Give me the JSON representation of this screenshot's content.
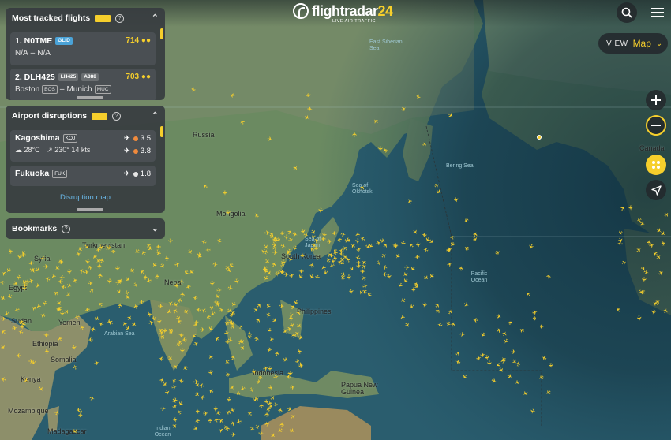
{
  "app": {
    "brand": "flightradar",
    "brand_num": "24",
    "tagline": "LIVE AIR TRAFFIC"
  },
  "view": {
    "label": "VIEW",
    "value": "Map"
  },
  "icons": {
    "search": "search-icon",
    "menu": "hamburger-menu-icon",
    "zoom_in": "plus-icon",
    "zoom_out": "minus-icon",
    "layers": "layers-icon",
    "locate": "location-arrow-icon"
  },
  "colors": {
    "accent": "#f6cf2c",
    "panel": "#373c40",
    "link": "#6ab8e8",
    "glider_tag": "#4aa3d8"
  },
  "tracked": {
    "title": "Most tracked flights",
    "items": [
      {
        "rank_callsign": "1. N0TME",
        "type": "GLID",
        "count": "714",
        "route_from": "N/A",
        "route_sep": "–",
        "route_to": "N/A"
      },
      {
        "rank_callsign": "2. DLH425",
        "flight": "LH425",
        "type": "A388",
        "count": "703",
        "route_from": "Boston",
        "from_code": "BOS",
        "route_sep": "–",
        "route_to": "Munich",
        "to_code": "MUC"
      }
    ]
  },
  "disruptions": {
    "title": "Airport disruptions",
    "items": [
      {
        "name": "Kagoshima",
        "code": "KOJ",
        "weather": "28°C",
        "wind": "230° 14 kts",
        "dep_index": "3.5",
        "arr_index": "3.8",
        "dep_color": "#f08a3c",
        "arr_color": "#f08a3c"
      },
      {
        "name": "Fukuoka",
        "code": "FUK",
        "dep_index": "1.8",
        "dep_color": "#e6e6e6"
      }
    ],
    "link": "Disruption map"
  },
  "bookmarks": {
    "title": "Bookmarks"
  },
  "map_labels": [
    {
      "text": "Russia",
      "kind": "country"
    },
    {
      "text": "Mongolia",
      "kind": "country"
    },
    {
      "text": "Turkmenistan",
      "kind": "country"
    },
    {
      "text": "Syria",
      "kind": "country"
    },
    {
      "text": "Egypt",
      "kind": "country"
    },
    {
      "text": "Sudan",
      "kind": "country"
    },
    {
      "text": "Yemen",
      "kind": "country"
    },
    {
      "text": "Ethiopia",
      "kind": "country"
    },
    {
      "text": "Somalia",
      "kind": "country"
    },
    {
      "text": "Kenya",
      "kind": "country"
    },
    {
      "text": "Mozambique",
      "kind": "country"
    },
    {
      "text": "Madagascar",
      "kind": "country"
    },
    {
      "text": "Nepal",
      "kind": "country"
    },
    {
      "text": "South Korea",
      "kind": "country"
    },
    {
      "text": "Philippines",
      "kind": "country"
    },
    {
      "text": "Indonesia",
      "kind": "country"
    },
    {
      "text": "Papua New Guinea",
      "kind": "country"
    },
    {
      "text": "Canada",
      "kind": "country"
    },
    {
      "text": "East Siberian Sea",
      "kind": "water"
    },
    {
      "text": "Sea of Okhotsk",
      "kind": "water"
    },
    {
      "text": "Bering Sea",
      "kind": "water"
    },
    {
      "text": "Sea of Japan",
      "kind": "water"
    },
    {
      "text": "Arabian Sea",
      "kind": "water"
    },
    {
      "text": "Indian Ocean",
      "kind": "water"
    },
    {
      "text": "Pacific Ocean",
      "kind": "water"
    }
  ]
}
